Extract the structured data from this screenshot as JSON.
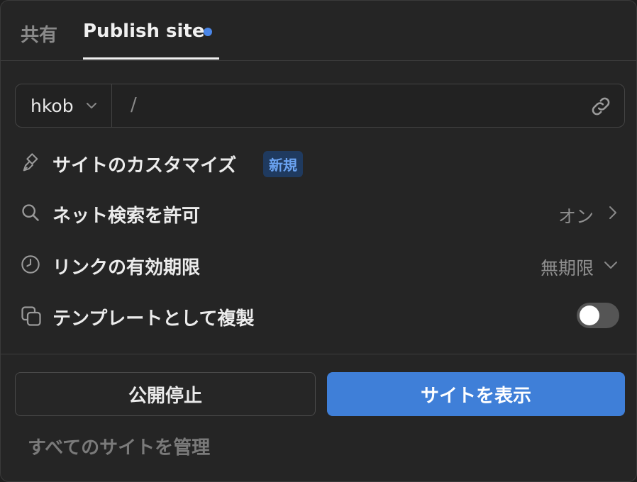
{
  "tabs": {
    "share_label": "共有",
    "publish_label": "Publish site"
  },
  "url": {
    "domain": "hkob",
    "separator": "/",
    "path_value": ""
  },
  "rows": {
    "customize": {
      "label": "サイトのカスタマイズ",
      "badge": "新規"
    },
    "search": {
      "label": "ネット検索を許可",
      "value": "オン"
    },
    "expiry": {
      "label": "リンクの有効期限",
      "value": "無期限"
    },
    "template": {
      "label": "テンプレートとして複製",
      "toggle_on": false
    }
  },
  "buttons": {
    "unpublish": "公開停止",
    "view_site": "サイトを表示"
  },
  "footer": {
    "manage_link": "すべてのサイトを管理"
  },
  "colors": {
    "accent": "#3f7fd8",
    "badge_bg": "#1f3a5f",
    "badge_text": "#6aa2f0",
    "dot": "#4a86e8"
  },
  "icons": [
    "chevron-down-icon",
    "link-icon",
    "paintbrush-icon",
    "search-icon",
    "clock-icon",
    "chevron-right-icon",
    "duplicate-icon"
  ]
}
